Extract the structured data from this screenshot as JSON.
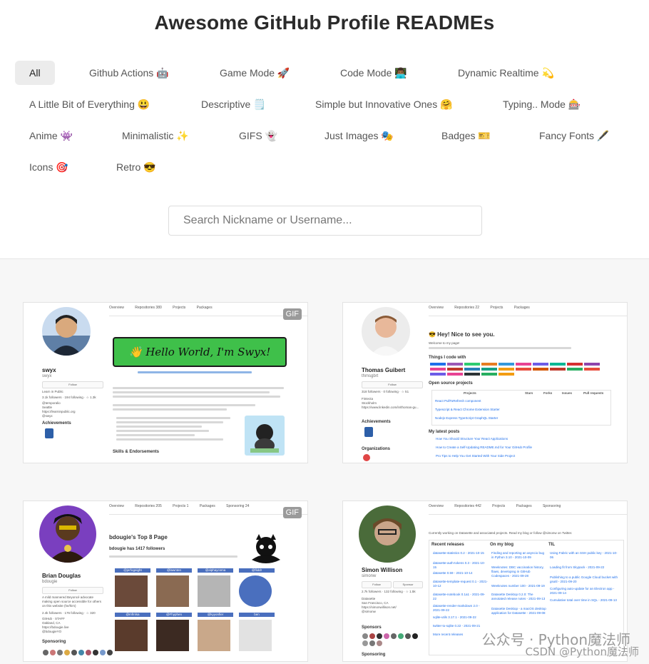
{
  "title": "Awesome GitHub Profile READMEs",
  "categories": [
    "All",
    "Github Actions 🤖",
    "Game Mode 🚀",
    "Code Mode 👨🏾‍💻",
    "Dynamic Realtime 💫",
    "A Little Bit of Everything 😃",
    "Descriptive 🗒️",
    "Simple but Innovative Ones 🤗",
    "Typing.. Mode 🎰",
    "Anime 👾",
    "Minimalistic ✨",
    "GIFS 👻",
    "Just Images 🎭",
    "Badges 🎫",
    "Fancy Fonts 🖋️",
    "Icons 🎯",
    "Retro 😎"
  ],
  "search": {
    "placeholder": "Search Nickname or Username..."
  },
  "cards": [
    {
      "badge": "GIF",
      "tabs": [
        "Overview",
        "Repositories 380",
        "Projects",
        "Packages"
      ],
      "name": "swyx",
      "username": "swyx",
      "follow": "Follow",
      "bio": "Learn in Public",
      "stats": "3.1k followers · 194 following · ☆ 1.3k",
      "meta": [
        "@temporalio",
        "Seattle",
        "https://learninpublic.org",
        "@swyx"
      ],
      "section_left": "Achievements",
      "banner": "👋 Hello World, I'm Swyx!",
      "heading": "Skills & Endorsements"
    },
    {
      "badge": "",
      "tabs": [
        "Overview",
        "Repositories 22",
        "Projects",
        "Packages"
      ],
      "name": "Thomas Guibert",
      "username": "thmsgbrt",
      "follow": "Follow",
      "stats": "318 followers · 0 following · ☆ 51",
      "meta": [
        "Fintecta",
        "Stockholm",
        "https://www.linkedin.com/in/thomas-gu..."
      ],
      "section_left": "Achievements",
      "section_left2": "Organizations",
      "heading": "😎 Hey! Nice to see you.",
      "intro": "Welcome to my page!",
      "h2": "Things I code with",
      "h3": "Open source projects",
      "h4": "My latest posts",
      "table_head": [
        "Projects",
        "Stars",
        "Forks",
        "Issues",
        "Pull requests"
      ],
      "projects": [
        "React PullToRefresh component",
        "Typescript & React Chrome Extension Starter",
        "Nodejs Express TypeScript GraphQL Starter"
      ],
      "posts": [
        "How You Should Structure Your React Applications",
        "How to Create a Self-Updating README.md for Your GitHub Profile",
        "Pro Tips to Help You Get Started With Your Side Project"
      ]
    },
    {
      "badge": "GIF",
      "tabs": [
        "Overview",
        "Repositories 205",
        "Projects 1",
        "Packages",
        "Sponsoring 24"
      ],
      "name": "Brian Douglas",
      "username": "bdougie",
      "follow": "Follow",
      "bio": "A mild mannered Beyoncé advocate making open source accessible for others on this website (he/him)",
      "stats": "2.4k followers · 176 following · ☆ 320",
      "meta": [
        "GitHub · STAFF",
        "Oakland, CA",
        "https://bdougie.live",
        "@bdougieYO"
      ],
      "section_left": "Sponsoring",
      "heading": "bdougie's Top 8 Page",
      "subheading": "bdougie has 1417 followers",
      "friends": [
        "@jerfogeight",
        "@lawnten",
        "@alphaycsma",
        "@fliddr",
        "@mfmlsa",
        "@Fhyphen",
        "@kyyonfier",
        "ben"
      ]
    },
    {
      "badge": "",
      "tabs": [
        "Overview",
        "Repositories 442",
        "Projects",
        "Packages",
        "Sponsoring"
      ],
      "name": "Simon Willison",
      "username": "simonw",
      "follow": "Follow",
      "sponsor": "Sponsor",
      "stats": "2.7k followers · 132 following · ☆ 1.5k",
      "meta": [
        "Datasette",
        "San Francisco, CA",
        "https://simonwillison.net/",
        "@simonw"
      ],
      "section_left": "Sponsors",
      "section_left2": "Sponsoring",
      "intro": "Currently working on Datasette and associated projects. Read my blog or follow @simonw on Twitter.",
      "col1": "Recent releases",
      "col2": "On my blog",
      "col3": "TIL",
      "releases": [
        "datasette-statistics 0.2 - 2021-10-15",
        "datasette-auth-tokens 0.3 - 2021-10-15",
        "datasette 0.59 - 2021-10-14",
        "datasette-template-request 0.1 - 2021-10-12",
        "datasette-notebook 0.1a1 - 2021-09-22",
        "datasette-render-markdown 2.0 - 2021-09-22",
        "sqlite-utils 3.17.1 - 2021-09-22",
        "twitter-to-sqlite 0.22 - 2021-09-21"
      ],
      "blog": [
        "Finding and reporting an asyncio bug in Python 3.10 - 2021-10-09",
        "Weeknotes: DBC vaccination history, flaws, developing in GitHub Codespaces - 2021-09-28",
        "Weeknotes number 100 - 2021-09-19",
        "Datasette Desktop 0.2.0: The annotated release notes - 2021-09-13",
        "Datasette Desktop - a macOS desktop application for Datasette - 2021-09-08"
      ],
      "til": [
        "Using Fabric with an SSH public key - 2021-10-06",
        "Loading fit from Skypack - 2021-09-22",
        "Publishing to a public Google Cloud bucket with gsutil - 2021-09-20",
        "Configuring auto-update for an Electron app - 2021-09-14",
        "Cumulative total over time in SQL - 2021-09-13"
      ],
      "more": "More recent releases"
    }
  ],
  "watermark": {
    "line1": "公众号 · Python魔法师",
    "line2": "CSDN @Python魔法师"
  }
}
